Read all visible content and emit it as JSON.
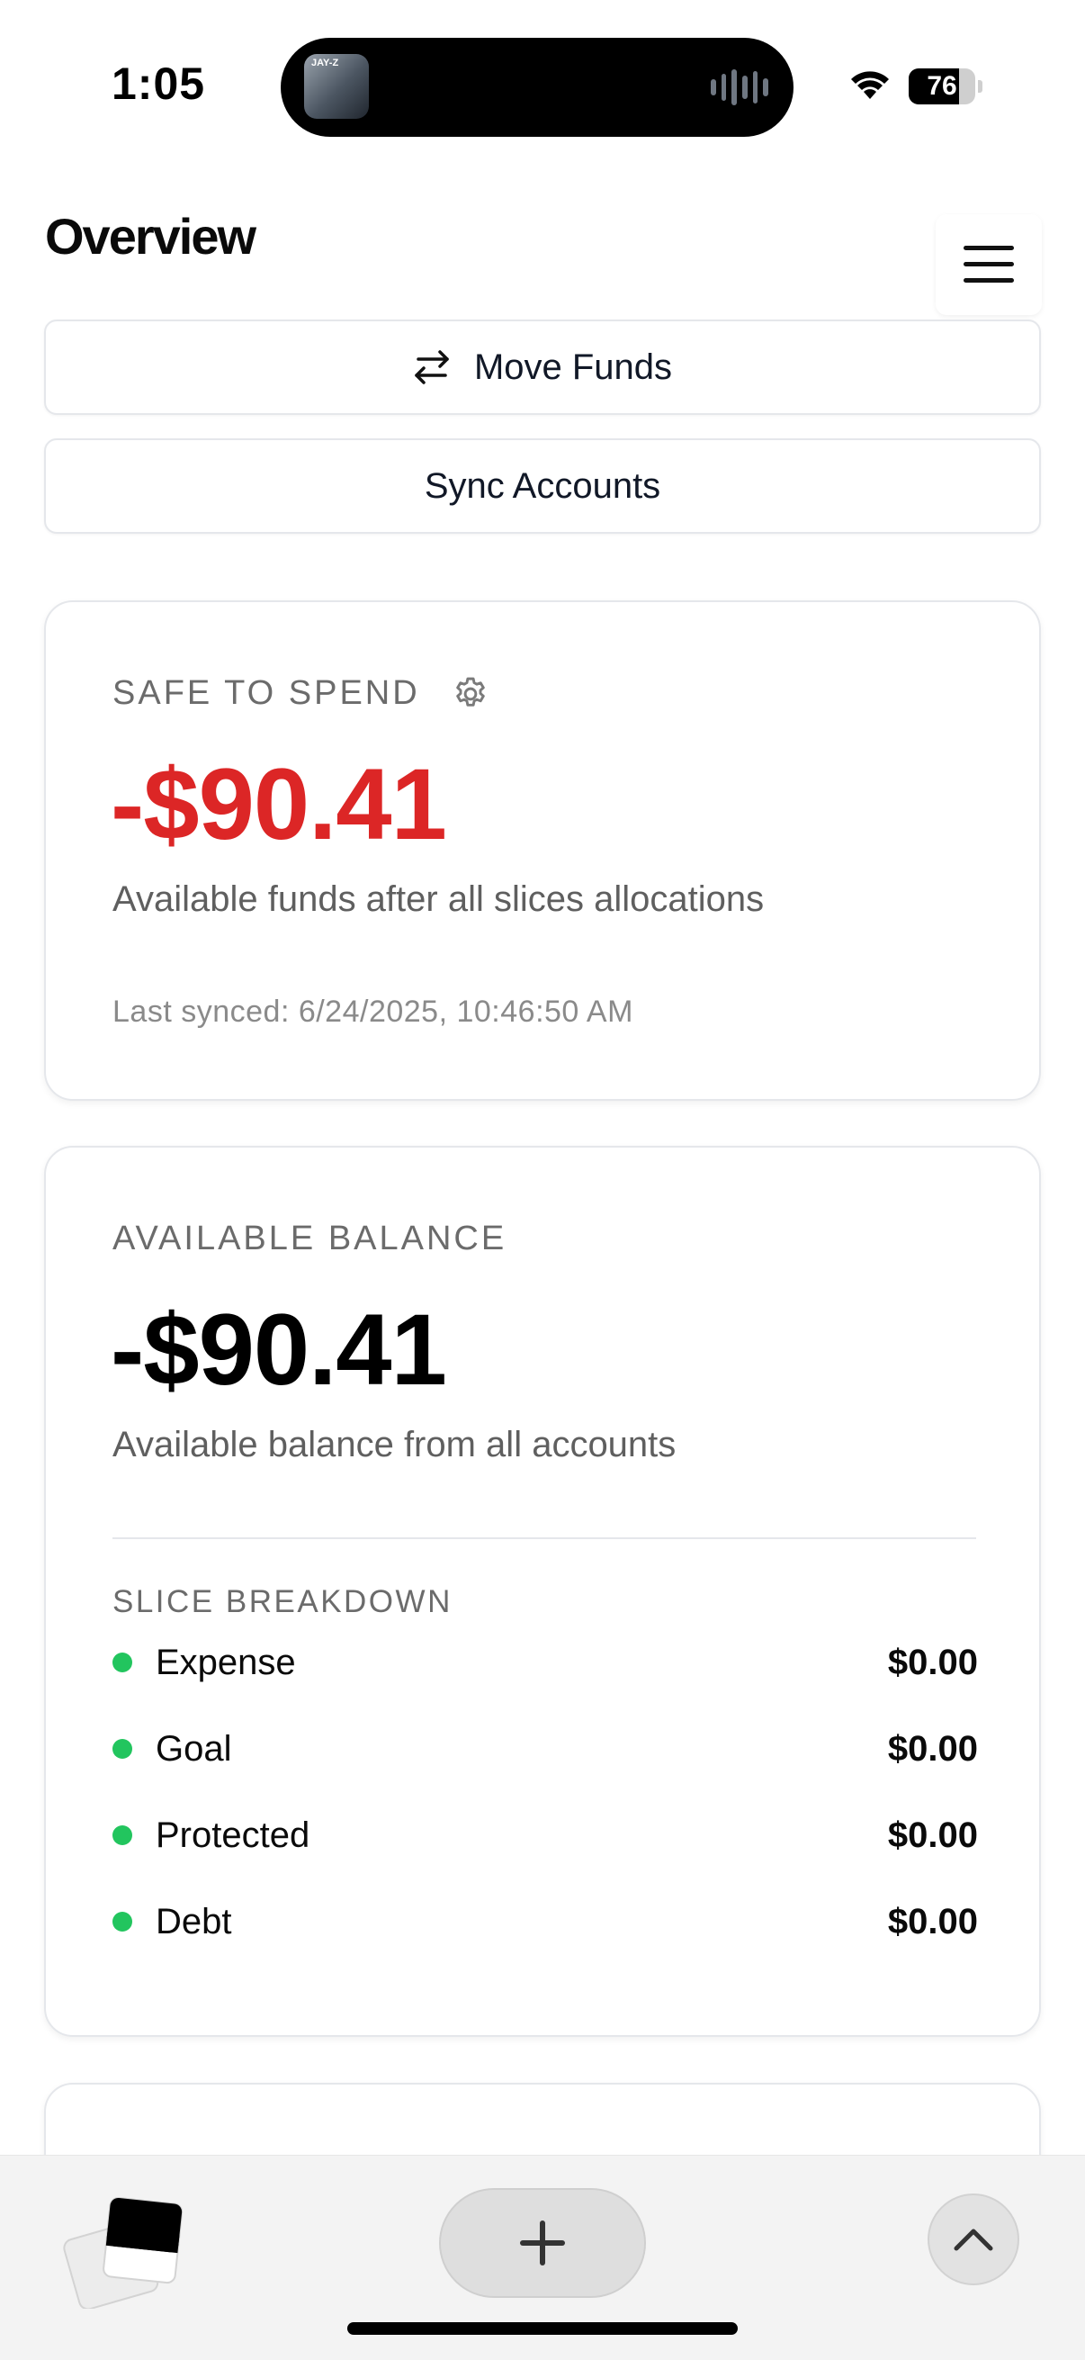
{
  "status_bar": {
    "time": "1:05",
    "battery_level": "76",
    "battery_fraction": 0.76,
    "album_text": "JAY-Z",
    "icons": [
      "waveform-icon",
      "wifi-icon",
      "battery-icon"
    ]
  },
  "header": {
    "title": "Overview",
    "menu_icon": "hamburger-menu-icon"
  },
  "actions": {
    "move_funds_label": "Move Funds",
    "move_funds_icon": "arrows-left-right-icon",
    "sync_accounts_label": "Sync Accounts"
  },
  "safe_to_spend": {
    "label": "SAFE TO SPEND",
    "settings_icon": "gear-icon",
    "amount": "-$90.41",
    "amount_color": "#dc2626",
    "description": "Available funds after all slices allocations",
    "last_synced": "Last synced: 6/24/2025, 10:46:50 AM"
  },
  "available_balance": {
    "label": "AVAILABLE BALANCE",
    "amount": "-$90.41",
    "description": "Available balance from all accounts",
    "breakdown_label": "SLICE BREAKDOWN",
    "slices": [
      {
        "name": "Expense",
        "value": "$0.00"
      },
      {
        "name": "Goal",
        "value": "$0.00"
      },
      {
        "name": "Protected",
        "value": "$0.00"
      },
      {
        "name": "Debt",
        "value": "$0.00"
      }
    ],
    "dot_color": "#22c55e"
  },
  "toolbar": {
    "tabs_icon": "tabs-icon",
    "add_icon": "plus-icon",
    "up_icon": "chevron-up-icon"
  }
}
